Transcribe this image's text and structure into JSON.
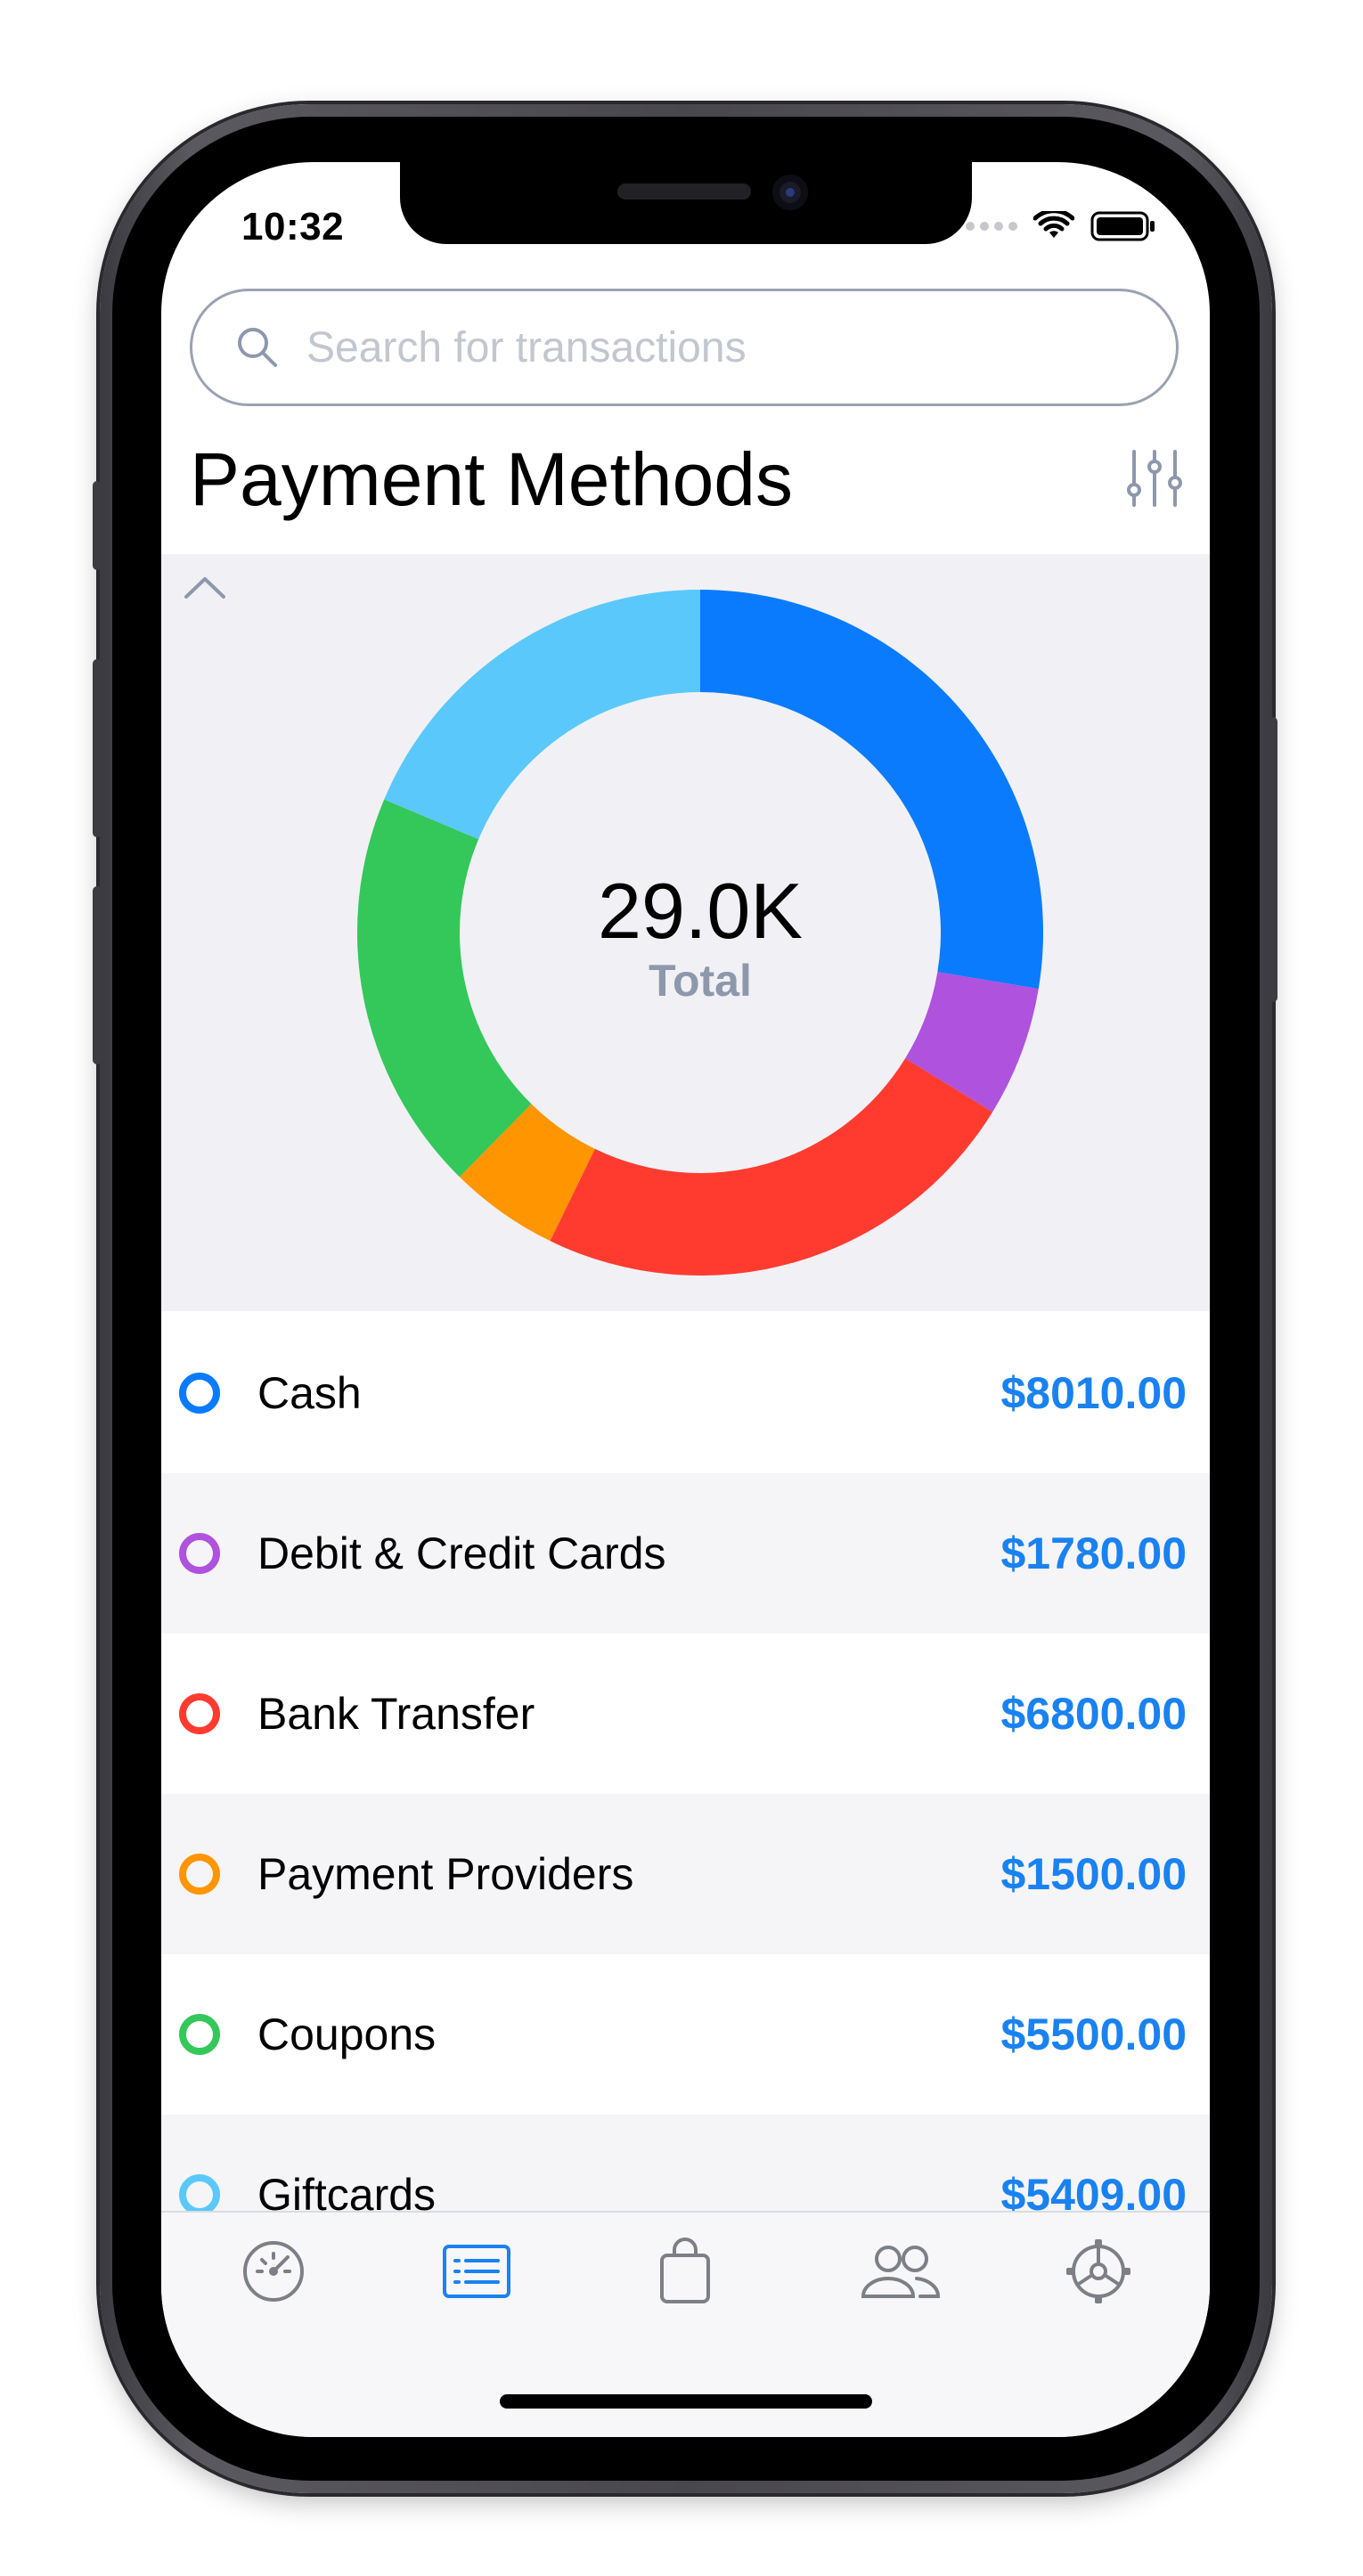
{
  "status_bar": {
    "time": "10:32"
  },
  "search": {
    "placeholder": "Search for transactions"
  },
  "page": {
    "title": "Payment Methods"
  },
  "chart_data": {
    "type": "pie",
    "total_value": "29.0K",
    "total_label": "Total",
    "categories": [
      "Cash",
      "Debit & Credit Cards",
      "Bank Transfer",
      "Payment Providers",
      "Coupons",
      "Giftcards"
    ],
    "values": [
      8010,
      1780,
      6800,
      1500,
      5500,
      5409
    ],
    "colors": [
      "#0a7bfd",
      "#af52de",
      "#ff3b30",
      "#ff9500",
      "#34c759",
      "#5ac8fa"
    ]
  },
  "methods": [
    {
      "label": "Cash",
      "amount": "$8010.00",
      "color": "#0a7bfd"
    },
    {
      "label": "Debit & Credit Cards",
      "amount": "$1780.00",
      "color": "#af52de"
    },
    {
      "label": "Bank Transfer",
      "amount": "$6800.00",
      "color": "#ff3b30"
    },
    {
      "label": "Payment Providers",
      "amount": "$1500.00",
      "color": "#ff9500"
    },
    {
      "label": "Coupons",
      "amount": "$5500.00",
      "color": "#34c759"
    },
    {
      "label": "Giftcards",
      "amount": "$5409.00",
      "color": "#5ac8fa"
    }
  ],
  "tab_bar": {
    "tabs": [
      {
        "icon": "dashboard-gauge-icon",
        "active": false
      },
      {
        "icon": "transactions-list-icon",
        "active": true
      },
      {
        "icon": "shopping-bag-icon",
        "active": false
      },
      {
        "icon": "contacts-people-icon",
        "active": false
      },
      {
        "icon": "settings-gear-icon",
        "active": false
      }
    ],
    "active_color": "#1a82f0",
    "inactive_color": "#7d7f86"
  }
}
